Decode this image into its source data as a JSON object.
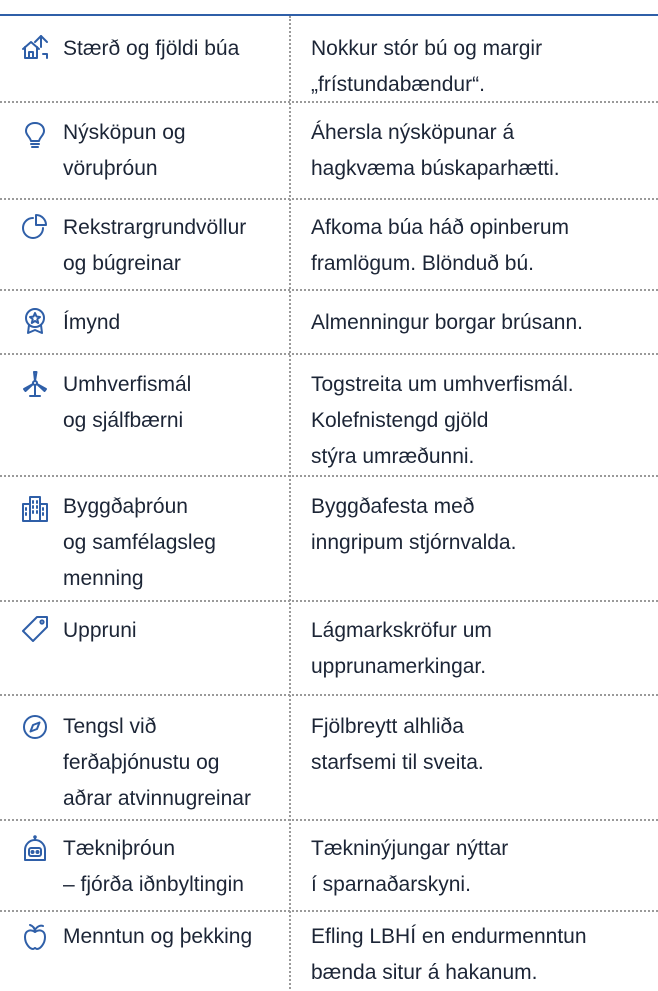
{
  "rows": [
    {
      "icon": "house-upgrade-icon",
      "label": [
        "Stærð og fjöldi búa"
      ],
      "desc": [
        "Nokkur stór bú og margir",
        "„frístundabændur“."
      ]
    },
    {
      "icon": "lightbulb-icon",
      "label": [
        "Nýsköpun og",
        "vöruþróun"
      ],
      "desc": [
        "Áhersla nýsköpunar á",
        "hagkvæma búskaparhætti."
      ]
    },
    {
      "icon": "pie-chart-icon",
      "label": [
        "Rekstrargrundvöllur",
        "og búgreinar"
      ],
      "desc": [
        "Afkoma búa háð opinberum",
        "framlögum. Blönduð bú."
      ]
    },
    {
      "icon": "award-badge-icon",
      "label": [
        "Ímynd"
      ],
      "desc": [
        "Almenningur borgar brúsann."
      ]
    },
    {
      "icon": "wind-turbine-icon",
      "label": [
        "Umhverfismál",
        "og sjálfbærni"
      ],
      "desc": [
        "Togstreita um umhverfismál.",
        "Kolefnistengd gjöld",
        "stýra umræðunni."
      ]
    },
    {
      "icon": "buildings-icon",
      "label": [
        "Byggðaþróun",
        "og samfélagsleg",
        "menning"
      ],
      "desc": [
        "Byggðafesta með",
        "inngripum stjórnvalda."
      ]
    },
    {
      "icon": "tag-icon",
      "label": [
        "Uppruni"
      ],
      "desc": [
        "Lágmarkskröfur um",
        "upprunamerkingar."
      ]
    },
    {
      "icon": "compass-icon",
      "label": [
        "Tengsl við",
        "ferðaþjónustu og",
        "aðrar atvinnugreinar"
      ],
      "desc": [
        "Fjölbreytt alhliða",
        "starfsemi til sveita."
      ]
    },
    {
      "icon": "robot-icon",
      "label": [
        "Tækniþróun",
        "– fjórða iðnbyltingin"
      ],
      "desc": [
        "Tækninýjungar nýttar",
        "í sparnaðarskyni."
      ]
    },
    {
      "icon": "apple-icon",
      "label": [
        "Menntun og þekking"
      ],
      "desc": [
        "Efling LBHÍ en endurmenntun",
        "bænda situr á hakanum."
      ]
    }
  ]
}
